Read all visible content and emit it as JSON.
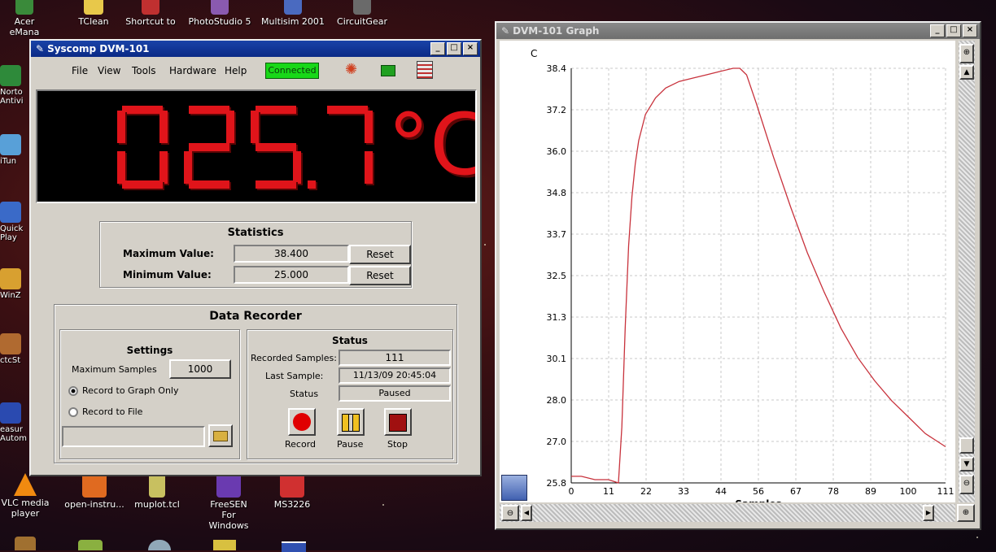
{
  "desktop": {
    "top_icons": [
      "Acer eMana",
      "TClean",
      "Shortcut to",
      "PhotoStudio 5",
      "Multisim 2001",
      "CircuitGear"
    ],
    "left_icons": [
      "Norto Antivi",
      "iTun",
      "Quick Play",
      "WinZ",
      "ctcSt",
      "easur Autom"
    ],
    "bottom_icons": [
      "VLC media player",
      "open-instru...",
      "muplot.tcl",
      "FreeSEN For Windows",
      "MS3226"
    ]
  },
  "dvm": {
    "title": "Syscomp DVM-101",
    "menu": [
      "File",
      "View",
      "Tools",
      "Hardware",
      "Help"
    ],
    "connected_label": "Connected",
    "reading": "025.7",
    "unit": "°C",
    "statistics": {
      "title": "Statistics",
      "max_label": "Maximum Value:",
      "max_value": "38.400",
      "min_label": "Minimum Value:",
      "min_value": "25.000",
      "reset_label": "Reset"
    },
    "recorder": {
      "title": "Data Recorder",
      "settings_title": "Settings",
      "max_samples_label": "Maximum Samples",
      "max_samples_value": "1000",
      "radio_graph": "Record to Graph Only",
      "radio_file": "Record to File",
      "file_path": "",
      "status_title": "Status",
      "recorded_label": "Recorded Samples:",
      "recorded_value": "111",
      "last_label": "Last Sample:",
      "last_value": "11/13/09 20:45:04",
      "status_label": "Status",
      "status_value": "Paused",
      "record_label": "Record",
      "pause_label": "Pause",
      "stop_label": "Stop"
    }
  },
  "graph": {
    "title": "DVM-101 Graph",
    "y_unit": "C",
    "xlabel": "Samples",
    "colors": {
      "line": "#c8323c",
      "grid": "#c8c8c8"
    }
  },
  "chart_data": {
    "type": "line",
    "xlabel": "Samples",
    "ylabel": "C",
    "x_ticks": [
      "0",
      "11",
      "22",
      "33",
      "44",
      "56",
      "67",
      "78",
      "89",
      "100",
      "111"
    ],
    "y_ticks": [
      "25.8",
      "27.0",
      "28.0",
      "30.1",
      "31.3",
      "32.5",
      "33.7",
      "34.8",
      "36.0",
      "37.2",
      "38.4"
    ],
    "xlim": [
      0,
      111
    ],
    "ylim": [
      25.8,
      38.4
    ],
    "grid": true,
    "series": [
      {
        "x": [
          0,
          3,
          7,
          11,
          14,
          15,
          16,
          17,
          18,
          19,
          20,
          22,
          25,
          28,
          32,
          36,
          40,
          44,
          48,
          50,
          52,
          55,
          60,
          65,
          70,
          75,
          80,
          85,
          90,
          95,
          100,
          105,
          111
        ],
        "y": [
          26.0,
          26.0,
          25.9,
          25.9,
          25.8,
          27.5,
          30.5,
          33.0,
          34.5,
          35.5,
          36.2,
          37.0,
          37.5,
          37.8,
          38.0,
          38.1,
          38.2,
          38.3,
          38.4,
          38.4,
          38.2,
          37.3,
          35.7,
          34.2,
          32.8,
          31.6,
          30.5,
          29.6,
          28.9,
          28.3,
          27.8,
          27.3,
          26.9
        ]
      }
    ]
  }
}
